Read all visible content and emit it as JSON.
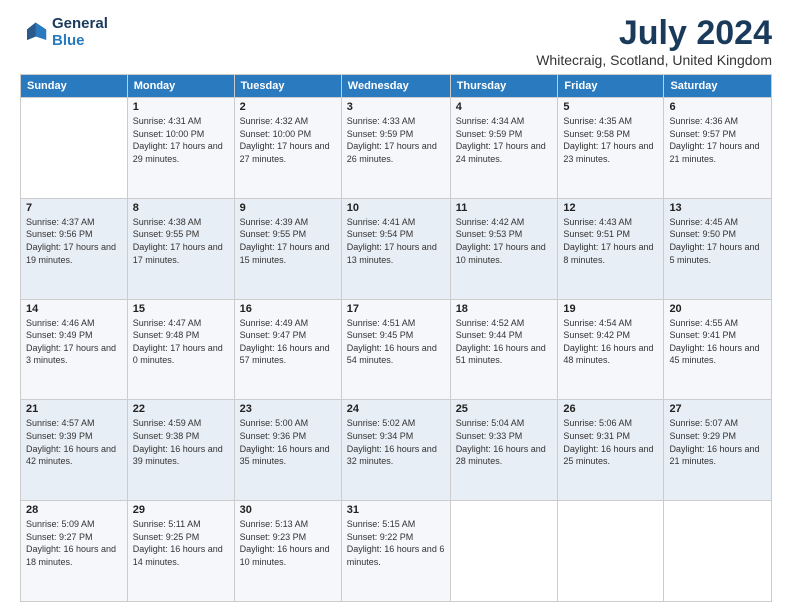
{
  "logo": {
    "line1": "General",
    "line2": "Blue"
  },
  "title": "July 2024",
  "location": "Whitecraig, Scotland, United Kingdom",
  "weekdays": [
    "Sunday",
    "Monday",
    "Tuesday",
    "Wednesday",
    "Thursday",
    "Friday",
    "Saturday"
  ],
  "weeks": [
    [
      {
        "day": "",
        "sunrise": "",
        "sunset": "",
        "daylight": ""
      },
      {
        "day": "1",
        "sunrise": "4:31 AM",
        "sunset": "10:00 PM",
        "daylight": "17 hours and 29 minutes."
      },
      {
        "day": "2",
        "sunrise": "4:32 AM",
        "sunset": "10:00 PM",
        "daylight": "17 hours and 27 minutes."
      },
      {
        "day": "3",
        "sunrise": "4:33 AM",
        "sunset": "9:59 PM",
        "daylight": "17 hours and 26 minutes."
      },
      {
        "day": "4",
        "sunrise": "4:34 AM",
        "sunset": "9:59 PM",
        "daylight": "17 hours and 24 minutes."
      },
      {
        "day": "5",
        "sunrise": "4:35 AM",
        "sunset": "9:58 PM",
        "daylight": "17 hours and 23 minutes."
      },
      {
        "day": "6",
        "sunrise": "4:36 AM",
        "sunset": "9:57 PM",
        "daylight": "17 hours and 21 minutes."
      }
    ],
    [
      {
        "day": "7",
        "sunrise": "4:37 AM",
        "sunset": "9:56 PM",
        "daylight": "17 hours and 19 minutes."
      },
      {
        "day": "8",
        "sunrise": "4:38 AM",
        "sunset": "9:55 PM",
        "daylight": "17 hours and 17 minutes."
      },
      {
        "day": "9",
        "sunrise": "4:39 AM",
        "sunset": "9:55 PM",
        "daylight": "17 hours and 15 minutes."
      },
      {
        "day": "10",
        "sunrise": "4:41 AM",
        "sunset": "9:54 PM",
        "daylight": "17 hours and 13 minutes."
      },
      {
        "day": "11",
        "sunrise": "4:42 AM",
        "sunset": "9:53 PM",
        "daylight": "17 hours and 10 minutes."
      },
      {
        "day": "12",
        "sunrise": "4:43 AM",
        "sunset": "9:51 PM",
        "daylight": "17 hours and 8 minutes."
      },
      {
        "day": "13",
        "sunrise": "4:45 AM",
        "sunset": "9:50 PM",
        "daylight": "17 hours and 5 minutes."
      }
    ],
    [
      {
        "day": "14",
        "sunrise": "4:46 AM",
        "sunset": "9:49 PM",
        "daylight": "17 hours and 3 minutes."
      },
      {
        "day": "15",
        "sunrise": "4:47 AM",
        "sunset": "9:48 PM",
        "daylight": "17 hours and 0 minutes."
      },
      {
        "day": "16",
        "sunrise": "4:49 AM",
        "sunset": "9:47 PM",
        "daylight": "16 hours and 57 minutes."
      },
      {
        "day": "17",
        "sunrise": "4:51 AM",
        "sunset": "9:45 PM",
        "daylight": "16 hours and 54 minutes."
      },
      {
        "day": "18",
        "sunrise": "4:52 AM",
        "sunset": "9:44 PM",
        "daylight": "16 hours and 51 minutes."
      },
      {
        "day": "19",
        "sunrise": "4:54 AM",
        "sunset": "9:42 PM",
        "daylight": "16 hours and 48 minutes."
      },
      {
        "day": "20",
        "sunrise": "4:55 AM",
        "sunset": "9:41 PM",
        "daylight": "16 hours and 45 minutes."
      }
    ],
    [
      {
        "day": "21",
        "sunrise": "4:57 AM",
        "sunset": "9:39 PM",
        "daylight": "16 hours and 42 minutes."
      },
      {
        "day": "22",
        "sunrise": "4:59 AM",
        "sunset": "9:38 PM",
        "daylight": "16 hours and 39 minutes."
      },
      {
        "day": "23",
        "sunrise": "5:00 AM",
        "sunset": "9:36 PM",
        "daylight": "16 hours and 35 minutes."
      },
      {
        "day": "24",
        "sunrise": "5:02 AM",
        "sunset": "9:34 PM",
        "daylight": "16 hours and 32 minutes."
      },
      {
        "day": "25",
        "sunrise": "5:04 AM",
        "sunset": "9:33 PM",
        "daylight": "16 hours and 28 minutes."
      },
      {
        "day": "26",
        "sunrise": "5:06 AM",
        "sunset": "9:31 PM",
        "daylight": "16 hours and 25 minutes."
      },
      {
        "day": "27",
        "sunrise": "5:07 AM",
        "sunset": "9:29 PM",
        "daylight": "16 hours and 21 minutes."
      }
    ],
    [
      {
        "day": "28",
        "sunrise": "5:09 AM",
        "sunset": "9:27 PM",
        "daylight": "16 hours and 18 minutes."
      },
      {
        "day": "29",
        "sunrise": "5:11 AM",
        "sunset": "9:25 PM",
        "daylight": "16 hours and 14 minutes."
      },
      {
        "day": "30",
        "sunrise": "5:13 AM",
        "sunset": "9:23 PM",
        "daylight": "16 hours and 10 minutes."
      },
      {
        "day": "31",
        "sunrise": "5:15 AM",
        "sunset": "9:22 PM",
        "daylight": "16 hours and 6 minutes."
      },
      {
        "day": "",
        "sunrise": "",
        "sunset": "",
        "daylight": ""
      },
      {
        "day": "",
        "sunrise": "",
        "sunset": "",
        "daylight": ""
      },
      {
        "day": "",
        "sunrise": "",
        "sunset": "",
        "daylight": ""
      }
    ]
  ],
  "labels": {
    "sunrise": "Sunrise:",
    "sunset": "Sunset:",
    "daylight": "Daylight:"
  }
}
